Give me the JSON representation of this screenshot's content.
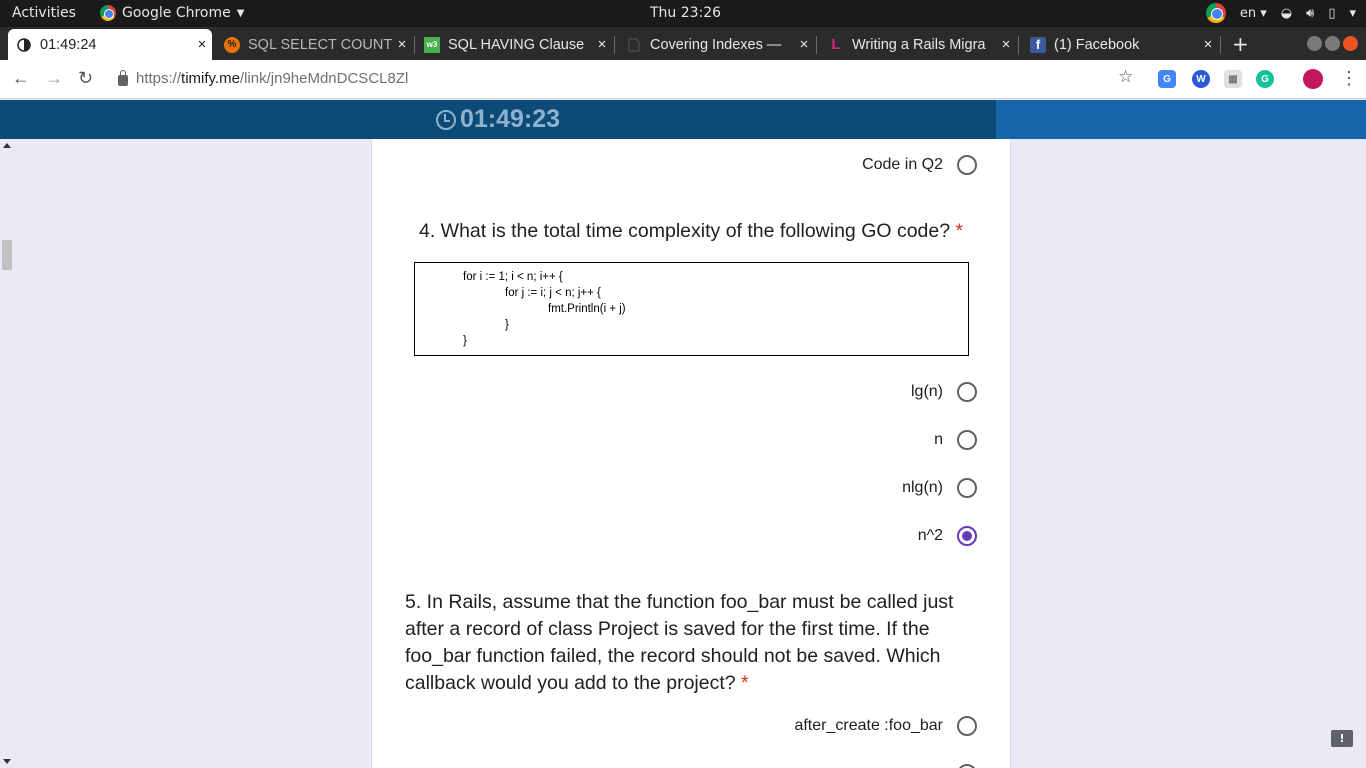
{
  "system_bar": {
    "activities": "Activities",
    "app_name": "Google Chrome",
    "clock": "Thu 23:26",
    "language": "en"
  },
  "tabs": [
    {
      "title": "01:49:24",
      "icon": "timer-icon"
    },
    {
      "title": "SQL SELECT COUNT,",
      "icon": "sql-site-icon"
    },
    {
      "title": "SQL HAVING Clause",
      "icon": "w3-icon"
    },
    {
      "title": "Covering Indexes —",
      "icon": "document-icon"
    },
    {
      "title": "Writing a Rails Migra",
      "icon": "lucidchart-icon"
    },
    {
      "title": "(1) Facebook",
      "icon": "facebook-icon"
    }
  ],
  "address_bar": {
    "url_scheme": "https://",
    "url_host": "timify.me",
    "url_path": "/link/jn9heMdnDCSCL8Zl"
  },
  "timer": {
    "value": "01:49:23"
  },
  "q3": {
    "options": [
      {
        "label": "Code in Q2",
        "checked": false
      }
    ]
  },
  "q4": {
    "question": "4. What is the total time complexity of the following GO code?",
    "required_mark": "*",
    "code_lines": [
      "for i := 1; i < n; i++ {",
      "for j := i; j < n; j++ {",
      "fmt.Println(i + j)",
      "}",
      "}"
    ],
    "options": [
      {
        "label": "lg(n)",
        "checked": false
      },
      {
        "label": "n",
        "checked": false
      },
      {
        "label": "nlg(n)",
        "checked": false
      },
      {
        "label": "n^2",
        "checked": true
      }
    ]
  },
  "q5": {
    "question_lines": [
      "5. In Rails, assume that the function foo_bar must be called just",
      "after a record of class Project is saved for the first time. If the",
      "foo_bar function failed, the record should not be saved. Which",
      "callback would you add to the project?"
    ],
    "required_mark": "*",
    "options": [
      {
        "label": "after_create :foo_bar",
        "checked": false
      }
    ]
  },
  "colors": {
    "timer_bar": "#0c4a78",
    "accent_radio": "#673ab7",
    "required": "#d93025",
    "page_background": "#ece9f7"
  }
}
